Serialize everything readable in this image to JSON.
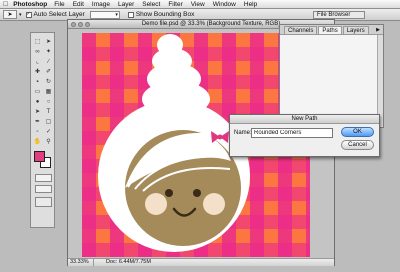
{
  "menubar": {
    "apple_icon": "apple-icon",
    "app_name": "Photoshop",
    "items": [
      "File",
      "Edit",
      "Image",
      "Layer",
      "Select",
      "Filter",
      "View",
      "Window",
      "Help"
    ]
  },
  "options_bar": {
    "tool_icon": "move-arrow-icon",
    "auto_select_label": "Auto Select Layer",
    "auto_select_checked": true,
    "bounding_box_label": "Show Bounding Box",
    "bounding_box_checked": false,
    "file_browser_label": "File Browser"
  },
  "toolbox": {
    "foreground_color": "#e23e7f",
    "background_color": "#ffffff"
  },
  "document": {
    "title": "Demo file.psd @ 33.3% (Background Texture, RGB)",
    "zoom": "33.33%",
    "doc_info": "Doc: 6.44M/7.75M",
    "plaid_colors": {
      "orange": "#fb7640",
      "pink": "#eb288c"
    },
    "illustration": {
      "face_color": "#a58a5a",
      "outline_color": "#ffffff",
      "cheek_color": "#f4e0c8",
      "bow_color": "#e2357f"
    }
  },
  "palette": {
    "tabs": [
      {
        "label": "Channels",
        "active": false
      },
      {
        "label": "Paths",
        "active": true
      },
      {
        "label": "Layers",
        "active": false
      }
    ]
  },
  "dialog": {
    "title": "New Path",
    "name_label": "Name:",
    "name_value": "Rounded Corners",
    "ok_label": "OK",
    "cancel_label": "Cancel"
  }
}
